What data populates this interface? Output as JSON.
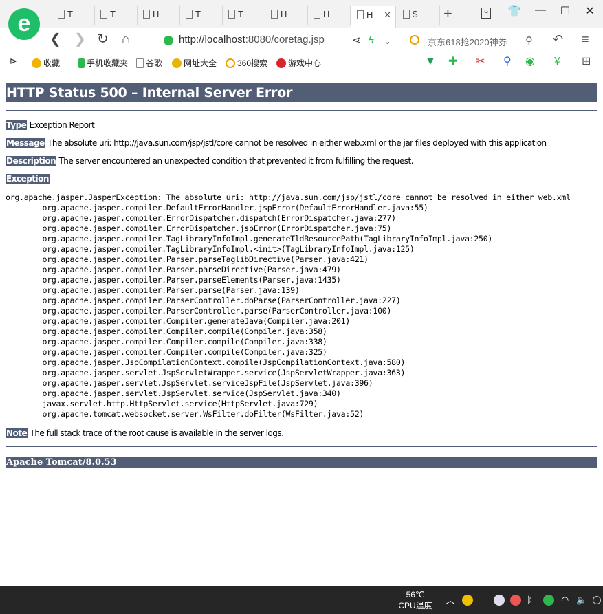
{
  "browser": {
    "tabs": [
      {
        "label": "T",
        "active": false
      },
      {
        "label": "T",
        "active": false
      },
      {
        "label": "H",
        "active": false
      },
      {
        "label": "T",
        "active": false
      },
      {
        "label": "T",
        "active": false
      },
      {
        "label": "H",
        "active": false
      },
      {
        "label": "H",
        "active": false
      },
      {
        "label": "H",
        "active": true
      },
      {
        "label": "$",
        "active": false
      }
    ],
    "tab_count": "9",
    "new_tab": "+",
    "address": {
      "scheme": "http://",
      "host": "localhost",
      "rest": ":8080/coretag.jsp"
    },
    "search_placeholder": "京东618抢2020神券",
    "bookmarks": [
      {
        "label": "收藏",
        "icon": "star-icon"
      },
      {
        "label": "手机收藏夹",
        "icon": "phone-icon"
      },
      {
        "label": "谷歌",
        "icon": "page-icon"
      },
      {
        "label": "网址大全",
        "icon": "globe-icon"
      },
      {
        "label": "360搜索",
        "icon": "360-search-icon"
      },
      {
        "label": "游戏中心",
        "icon": "game-icon"
      }
    ]
  },
  "page": {
    "title": "HTTP Status 500 – Internal Server Error",
    "type_label": "Type",
    "type_value": " Exception Report",
    "message_label": "Message",
    "message_value": " The absolute uri: http://java.sun.com/jsp/jstl/core cannot be resolved in either web.xml or the jar files deployed with this application",
    "description_label": "Description",
    "description_value": " The server encountered an unexpected condition that prevented it from fulfilling the request.",
    "exception_label": "Exception",
    "exception_first": "org.apache.jasper.JasperException: The absolute uri: http://java.sun.com/jsp/jstl/core cannot be resolved in either web.xml",
    "stack": [
      "org.apache.jasper.compiler.DefaultErrorHandler.jspError(DefaultErrorHandler.java:55)",
      "org.apache.jasper.compiler.ErrorDispatcher.dispatch(ErrorDispatcher.java:277)",
      "org.apache.jasper.compiler.ErrorDispatcher.jspError(ErrorDispatcher.java:75)",
      "org.apache.jasper.compiler.TagLibraryInfoImpl.generateTldResourcePath(TagLibraryInfoImpl.java:250)",
      "org.apache.jasper.compiler.TagLibraryInfoImpl.<init>(TagLibraryInfoImpl.java:125)",
      "org.apache.jasper.compiler.Parser.parseTaglibDirective(Parser.java:421)",
      "org.apache.jasper.compiler.Parser.parseDirective(Parser.java:479)",
      "org.apache.jasper.compiler.Parser.parseElements(Parser.java:1435)",
      "org.apache.jasper.compiler.Parser.parse(Parser.java:139)",
      "org.apache.jasper.compiler.ParserController.doParse(ParserController.java:227)",
      "org.apache.jasper.compiler.ParserController.parse(ParserController.java:100)",
      "org.apache.jasper.compiler.Compiler.generateJava(Compiler.java:201)",
      "org.apache.jasper.compiler.Compiler.compile(Compiler.java:358)",
      "org.apache.jasper.compiler.Compiler.compile(Compiler.java:338)",
      "org.apache.jasper.compiler.Compiler.compile(Compiler.java:325)",
      "org.apache.jasper.JspCompilationContext.compile(JspCompilationContext.java:580)",
      "org.apache.jasper.servlet.JspServletWrapper.service(JspServletWrapper.java:363)",
      "org.apache.jasper.servlet.JspServlet.serviceJspFile(JspServlet.java:396)",
      "org.apache.jasper.servlet.JspServlet.service(JspServlet.java:340)",
      "javax.servlet.http.HttpServlet.service(HttpServlet.java:729)",
      "org.apache.tomcat.websocket.server.WsFilter.doFilter(WsFilter.java:52)"
    ],
    "note_label": "Note",
    "note_value": " The full stack trace of the root cause is available in the server logs.",
    "footer": "Apache Tomcat/8.0.53"
  },
  "taskbar": {
    "temp": "56℃",
    "temp_label": "CPU温度"
  },
  "colors": {
    "heading_bg": "#525d76",
    "taskbar_bg": "#262626",
    "brand": "#1fbf6a"
  }
}
